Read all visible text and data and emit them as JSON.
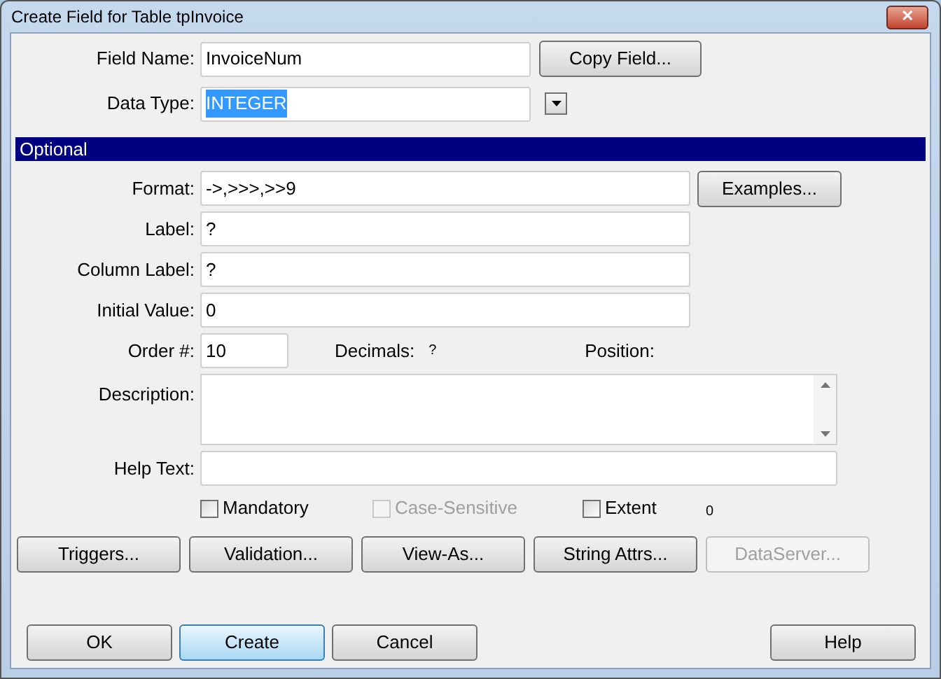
{
  "window": {
    "title": "Create Field for Table tpInvoice",
    "close": "✕"
  },
  "top_fields": [
    {
      "label": "Field Name:",
      "value": "InvoiceNum",
      "text_selected": false,
      "button": "Copy Field...",
      "kind": "button"
    },
    {
      "label": "Data Type:",
      "value": "INTEGER",
      "text_selected": true,
      "kind": "dropdown"
    }
  ],
  "section": {
    "title": "Optional"
  },
  "fields": [
    {
      "label": "Format:",
      "value": "->,>>>,>>9",
      "button": "Examples..."
    },
    {
      "label": "Label:",
      "value": "?"
    },
    {
      "label": "Column Label:",
      "value": "?"
    },
    {
      "label": "Initial Value:",
      "value": "0"
    }
  ],
  "order": {
    "label": "Order #:",
    "value": "10",
    "decimals_label": "Decimals:",
    "decimals_value": "?",
    "position_label": "Position:"
  },
  "description": {
    "label": "Description:"
  },
  "help_text": {
    "label": "Help Text:"
  },
  "checkboxes": [
    {
      "label": "Mandatory",
      "checked": false,
      "disabled": false
    },
    {
      "label": "Case-Sensitive",
      "checked": false,
      "disabled": true
    },
    {
      "label": "Extent",
      "checked": false,
      "disabled": false
    }
  ],
  "extent_value": "0",
  "action_buttons": [
    {
      "label": "Triggers...",
      "disabled": false
    },
    {
      "label": "Validation...",
      "disabled": false
    },
    {
      "label": "View-As...",
      "disabled": false
    },
    {
      "label": "String Attrs...",
      "disabled": false
    },
    {
      "label": "DataServer...",
      "disabled": true
    }
  ],
  "footer_buttons": [
    {
      "label": "OK",
      "highlighted": false
    },
    {
      "label": "Create",
      "highlighted": true
    },
    {
      "label": "Cancel",
      "highlighted": false
    },
    {
      "label": "Help",
      "highlighted": false
    }
  ]
}
